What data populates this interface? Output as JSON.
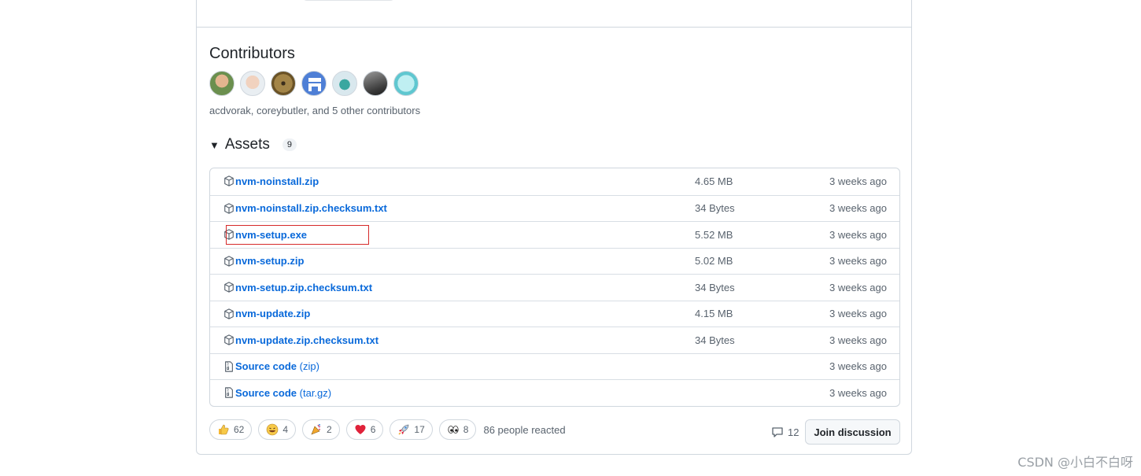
{
  "contributors": {
    "title": "Contributors",
    "summary": "acdvorak, coreybutler, and 5 other contributors",
    "avatars": [
      "acdvorak",
      "coreybutler",
      "contributor-3",
      "contributor-4",
      "contributor-5",
      "contributor-6",
      "contributor-7"
    ]
  },
  "assets": {
    "title": "Assets",
    "count": "9",
    "items": [
      {
        "name": "nvm-noinstall.zip",
        "suffix": "",
        "size": "4.65 MB",
        "date": "3 weeks ago",
        "icon": "package-icon"
      },
      {
        "name": "nvm-noinstall.zip.checksum.txt",
        "suffix": "",
        "size": "34 Bytes",
        "date": "3 weeks ago",
        "icon": "package-icon"
      },
      {
        "name": "nvm-setup.exe",
        "suffix": "",
        "size": "5.52 MB",
        "date": "3 weeks ago",
        "icon": "package-icon"
      },
      {
        "name": "nvm-setup.zip",
        "suffix": "",
        "size": "5.02 MB",
        "date": "3 weeks ago",
        "icon": "package-icon"
      },
      {
        "name": "nvm-setup.zip.checksum.txt",
        "suffix": "",
        "size": "34 Bytes",
        "date": "3 weeks ago",
        "icon": "package-icon"
      },
      {
        "name": "nvm-update.zip",
        "suffix": "",
        "size": "4.15 MB",
        "date": "3 weeks ago",
        "icon": "package-icon"
      },
      {
        "name": "nvm-update.zip.checksum.txt",
        "suffix": "",
        "size": "34 Bytes",
        "date": "3 weeks ago",
        "icon": "package-icon"
      },
      {
        "name": "Source code",
        "suffix": " (zip)",
        "size": "",
        "date": "3 weeks ago",
        "icon": "file-zip-icon"
      },
      {
        "name": "Source code",
        "suffix": " (tar.gz)",
        "size": "",
        "date": "3 weeks ago",
        "icon": "file-zip-icon"
      }
    ]
  },
  "reactions": {
    "items": [
      {
        "icon": "thumbs-up-icon",
        "count": "62"
      },
      {
        "icon": "laugh-icon",
        "count": "4"
      },
      {
        "icon": "hooray-icon",
        "count": "2"
      },
      {
        "icon": "heart-icon",
        "count": "6"
      },
      {
        "icon": "rocket-icon",
        "count": "17"
      },
      {
        "icon": "eyes-icon",
        "count": "8"
      }
    ],
    "summary": "86 people reacted"
  },
  "discussion": {
    "comment_count": "12",
    "join_label": "Join discussion"
  },
  "watermark": "CSDN @小白不白呀",
  "colors": {
    "link": "#0969da",
    "border": "#d0d7de",
    "muted": "#59636e",
    "highlight": "#d62a2a"
  }
}
